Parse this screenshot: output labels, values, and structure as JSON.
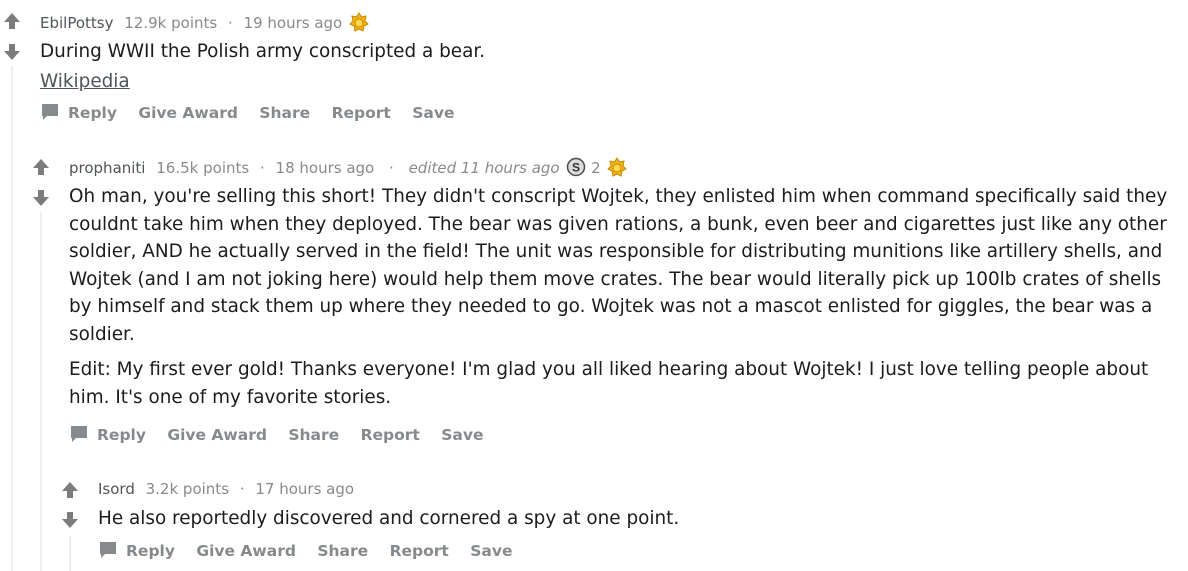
{
  "comments": [
    {
      "author": "EbilPottsy",
      "points": "12.9k points",
      "time": "19 hours ago",
      "body": "During WWII the Polish army conscripted a bear.",
      "link": "Wikipedia",
      "actions": [
        "Reply",
        "Give Award",
        "Share",
        "Report",
        "Save"
      ]
    },
    {
      "author": "prophaniti",
      "points": "16.5k points",
      "time": "18 hours ago",
      "edited": "edited 11 hours ago",
      "silver_count": "2",
      "body": "Oh man, you're selling this short! They didn't conscript Wojtek, they enlisted him when command specifically said they couldnt take him when they deployed. The bear was given rations, a bunk, even beer and cigarettes just like any other soldier, AND he actually served in the field! The unit was responsible for distributing munitions like artillery shells, and Wojtek (and I am not joking here) would help them move crates. The bear would literally pick up 100lb crates of shells by himself and stack them up where they needed to go. Wojtek was not a mascot enlisted for giggles, the bear was a soldier.",
      "body2": "Edit: My first ever gold! Thanks everyone! I'm glad you all liked hearing about Wojtek! I just love telling people about him. It's one of my favorite stories.",
      "actions": [
        "Reply",
        "Give Award",
        "Share",
        "Report",
        "Save"
      ]
    },
    {
      "author": "Isord",
      "points": "3.2k points",
      "time": "17 hours ago",
      "body": "He also reportedly discovered and cornered a spy at one point.",
      "actions": [
        "Reply",
        "Give Award",
        "Share",
        "Report",
        "Save"
      ]
    }
  ],
  "icons": {
    "upvote": "arrow-up-icon",
    "downvote": "arrow-down-icon",
    "award": "gold-award-icon",
    "silver": "silver-award-icon",
    "reply": "comment-bubble-icon"
  },
  "colors": {
    "vote_arrow": "#7c7c7c",
    "muted": "#878a8c",
    "gold": "#f2b318",
    "thread_line": "#edeff1"
  }
}
